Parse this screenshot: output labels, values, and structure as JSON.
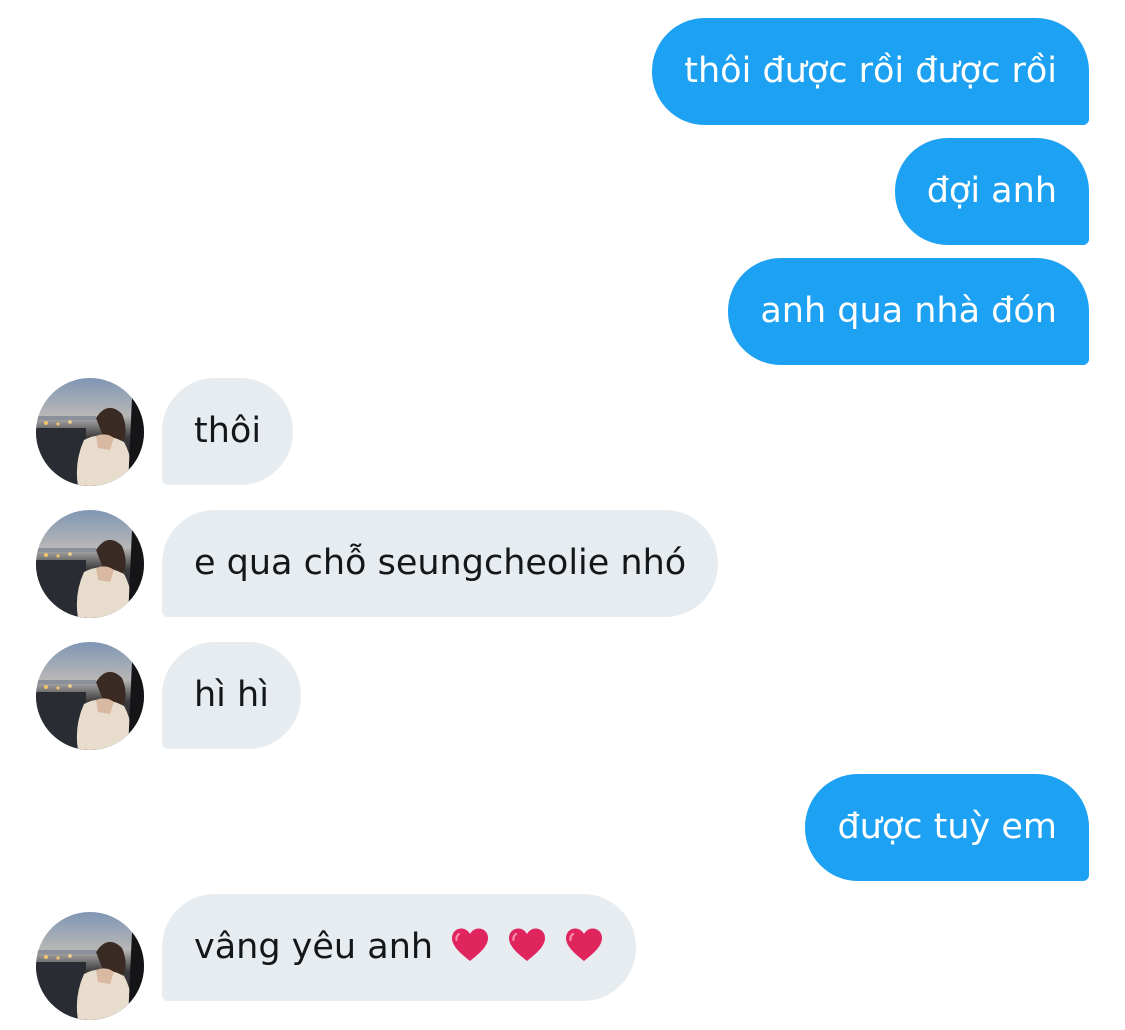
{
  "conversation": {
    "messages": [
      {
        "sender": "me",
        "text": "thôi được rồi được rồi"
      },
      {
        "sender": "me",
        "text": "đợi anh"
      },
      {
        "sender": "me",
        "text": "anh qua nhà đón"
      },
      {
        "sender": "them",
        "text": "thôi"
      },
      {
        "sender": "them",
        "text": "e qua chỗ seungcheolie nhó"
      },
      {
        "sender": "them",
        "text": "hì hì"
      },
      {
        "sender": "me",
        "text": "được tuỳ em"
      },
      {
        "sender": "them",
        "text": "vâng yêu anh",
        "emoji": [
          "red-heart-emoji",
          "red-heart-emoji",
          "red-heart-emoji"
        ]
      }
    ]
  },
  "colors": {
    "sent_bubble": "#1da1f2",
    "sent_text": "#ffffff",
    "received_bubble": "#e6ecf0",
    "received_text": "#14171a",
    "heart": "#e0245e"
  },
  "icons": {
    "avatar": "contact-avatar-photo",
    "heart": "red-heart-emoji"
  }
}
